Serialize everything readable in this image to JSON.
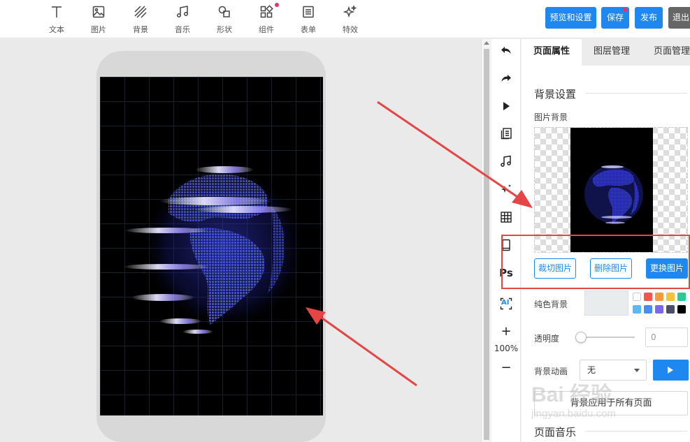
{
  "toolbar": {
    "tools": [
      {
        "label": "文本",
        "icon": "text-icon"
      },
      {
        "label": "图片",
        "icon": "image-icon"
      },
      {
        "label": "背景",
        "icon": "background-icon"
      },
      {
        "label": "音乐",
        "icon": "music-icon"
      },
      {
        "label": "形状",
        "icon": "shape-icon"
      },
      {
        "label": "组件",
        "icon": "component-icon"
      },
      {
        "label": "表单",
        "icon": "form-icon"
      },
      {
        "label": "特效",
        "icon": "effects-icon"
      }
    ],
    "buttons": {
      "preview": "预览和设置",
      "save": "保存",
      "publish": "发布",
      "exit": "退出"
    }
  },
  "side_tools": {
    "items": [
      "undo-icon",
      "redo-icon",
      "play-icon",
      "pages-icon",
      "music-icon",
      "sparkle-icon",
      "table-icon",
      "phone-icon",
      "ps-icon",
      "ai-icon"
    ],
    "ps_label": "Ps",
    "ai_label": "AI",
    "zoom_in": "+",
    "zoom_value": "100%",
    "zoom_out": "−"
  },
  "panel": {
    "tabs": [
      "页面属性",
      "图层管理",
      "页面管理"
    ],
    "active_tab": "页面属性",
    "background_section": "背景设置",
    "image_bg_label": "图片背景",
    "buttons": {
      "crop": "裁切图片",
      "delete": "删除图片",
      "replace": "更换图片"
    },
    "solid_bg_label": "纯色背景",
    "swatches": [
      "#ffffff",
      "#f0564b",
      "#f39c3d",
      "#f6c23c",
      "#2bc993",
      "#5cb8f3",
      "#4a8cf0",
      "#7b67e8",
      "#4a4e69",
      "#000000"
    ],
    "opacity_label": "透明度",
    "opacity_value": "0",
    "animation_label": "背景动画",
    "animation_value": "无",
    "apply_all": "背景应用于所有页面",
    "music_section": "页面音乐"
  },
  "watermark": {
    "brand": "Bai 经验",
    "url": "jingyan.baidu.com"
  },
  "colors": {
    "accent": "#1e88f0",
    "annotation": "#e64545"
  }
}
